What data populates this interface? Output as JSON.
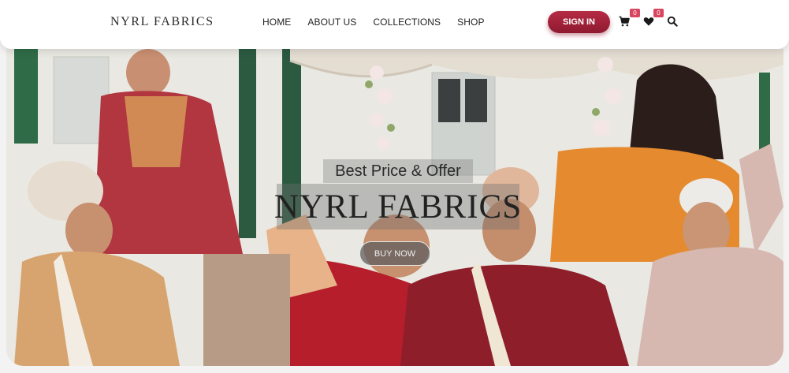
{
  "brand": {
    "logo_text": "NYRL FABRICS"
  },
  "nav": {
    "items": [
      {
        "label": "HOME"
      },
      {
        "label": "ABOUT US"
      },
      {
        "label": "COLLECTIONS"
      },
      {
        "label": "SHOP"
      }
    ]
  },
  "header": {
    "signin_label": "SIGN IN",
    "cart_count": "0",
    "wishlist_count": "0",
    "icons": [
      "cart-icon",
      "heart-icon",
      "search-icon"
    ]
  },
  "hero": {
    "tagline": "Best Price & Offer",
    "title": "NYRL FABRICS",
    "cta_label": "BUY NOW"
  },
  "colors": {
    "accent": "#9c1f37",
    "badge": "#d9455f",
    "header_bg": "#ffffff"
  }
}
